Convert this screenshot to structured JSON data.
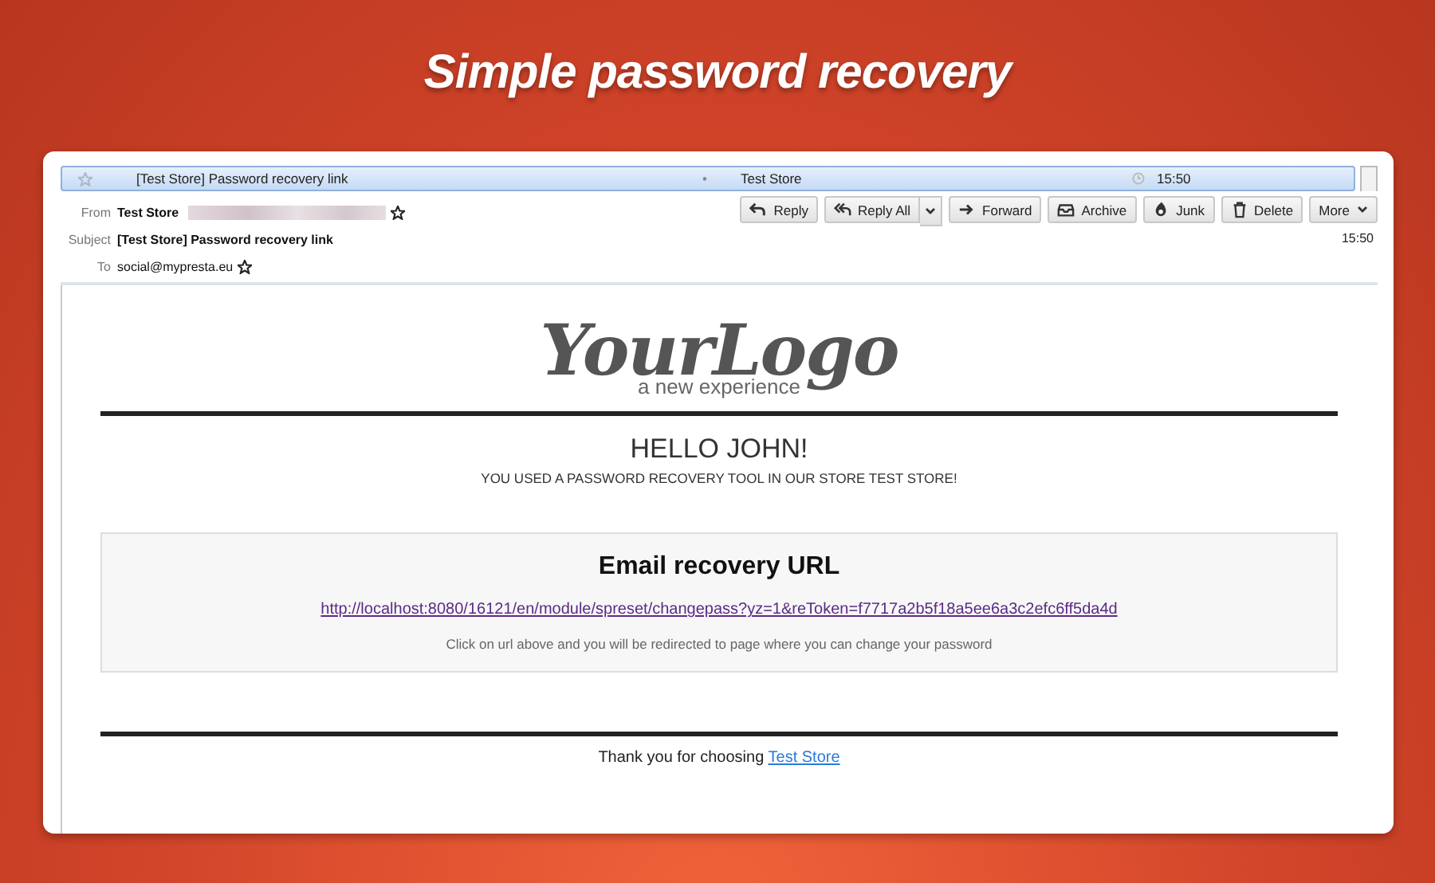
{
  "banner": {
    "title": "Simple password recovery"
  },
  "message_list": {
    "row": {
      "subject": "[Test Store] Password recovery link",
      "dot": "•",
      "sender": "Test Store",
      "time": "15:50",
      "selected": true
    }
  },
  "header": {
    "fields": [
      {
        "label": "From",
        "value": "Test Store",
        "starred": true,
        "kind": "sender"
      },
      {
        "label": "Subject",
        "value": "[Test Store] Password recovery link",
        "kind": "subject"
      },
      {
        "label": "To",
        "value": "social@mypresta.eu",
        "starred": true,
        "kind": "plain"
      }
    ],
    "time": "15:50",
    "buttons": [
      {
        "label": "Reply",
        "kind": "plain"
      },
      {
        "label": "Reply All",
        "kind": "split"
      },
      {
        "label": "Forward",
        "kind": "plain"
      },
      {
        "label": "Archive",
        "kind": "plain"
      },
      {
        "label": "Junk",
        "kind": "plain"
      },
      {
        "label": "Delete",
        "kind": "plain"
      },
      {
        "label": "More",
        "kind": "menu"
      }
    ]
  },
  "email": {
    "logo": {
      "script": "YourLogo",
      "tagline": "a new experience"
    },
    "greeting": "HELLO JOHN!",
    "intro": "YOU USED A PASSWORD RECOVERY TOOL IN OUR STORE TEST STORE!",
    "recovery_box": {
      "heading": "Email recovery URL",
      "link": "http://localhost:8080/16121/en/module/spreset/changepass?yz=1&reToken=f7717a2b5f18a5ee6a3c2efc6ff5da4d",
      "note": "Click on url above and you will be redirected to page where you can change your password"
    },
    "footer": {
      "text": "Thank you for choosing",
      "link": "Test Store"
    }
  }
}
